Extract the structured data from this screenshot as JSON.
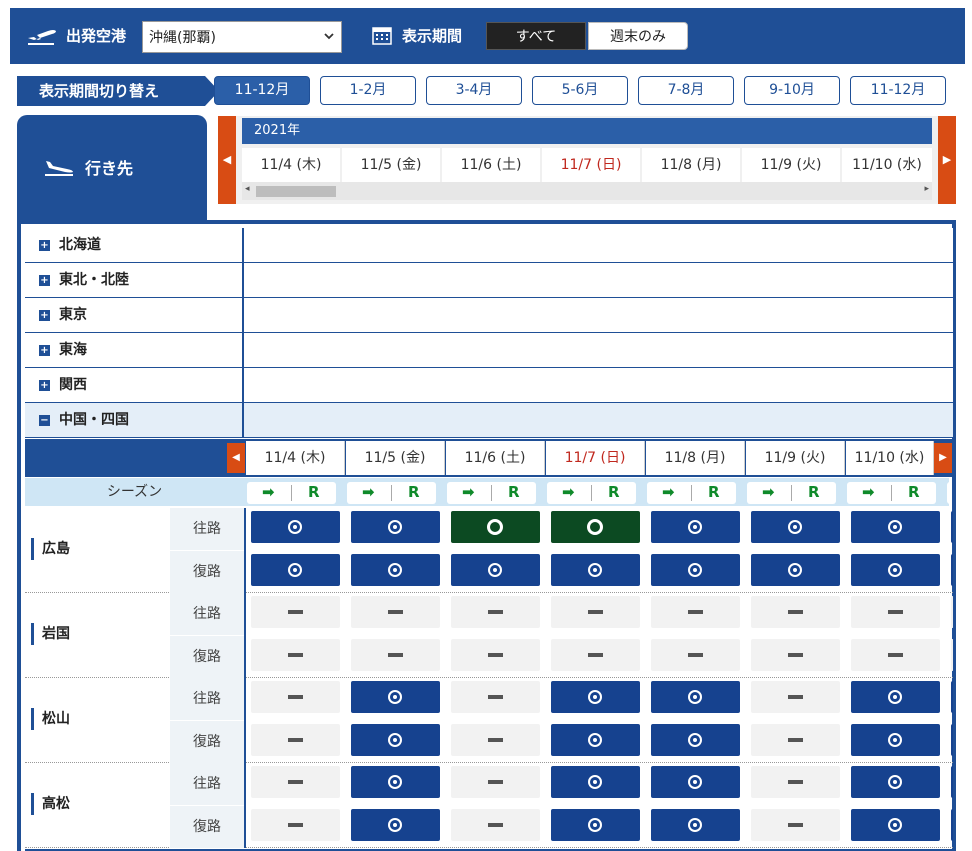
{
  "header": {
    "departure_label": "出発空港",
    "departure_value": "沖縄(那覇)",
    "period_label": "表示期間",
    "toggle_all": "すべて",
    "toggle_weekend": "週末のみ"
  },
  "period_switch": {
    "label": "表示期間切り替え",
    "options": [
      "11-12月",
      "1-2月",
      "3-4月",
      "5-6月",
      "7-8月",
      "9-10月",
      "11-12月"
    ]
  },
  "destination_label": "行き先",
  "year": "2021年",
  "dates": [
    {
      "label": "11/4 (木)",
      "color": "#333333"
    },
    {
      "label": "11/5 (金)",
      "color": "#333333"
    },
    {
      "label": "11/6 (土)",
      "color": "#333333"
    },
    {
      "label": "11/7 (日)",
      "color": "#c0281e"
    },
    {
      "label": "11/8 (月)",
      "color": "#333333"
    },
    {
      "label": "11/9 (火)",
      "color": "#333333"
    },
    {
      "label": "11/10 (水)",
      "color": "#333333"
    }
  ],
  "regions": [
    {
      "name": "北海道",
      "toggle": "+"
    },
    {
      "name": "東北・北陸",
      "toggle": "+"
    },
    {
      "name": "東京",
      "toggle": "+"
    },
    {
      "name": "東海",
      "toggle": "+"
    },
    {
      "name": "関西",
      "toggle": "+"
    },
    {
      "name": "中国・四国",
      "toggle": "−"
    }
  ],
  "season_label": "シーズン",
  "season_marks": {
    "arrow": "➡",
    "r": "R"
  },
  "directions": {
    "outbound": "往路",
    "return": "復路"
  },
  "cities": [
    {
      "name": "広島",
      "outbound": [
        "avail",
        "avail",
        "few",
        "few",
        "avail",
        "avail",
        "avail"
      ],
      "return": [
        "avail",
        "avail",
        "avail",
        "avail",
        "avail",
        "avail",
        "avail"
      ]
    },
    {
      "name": "岩国",
      "outbound": [
        "none",
        "none",
        "none",
        "none",
        "none",
        "none",
        "none"
      ],
      "return": [
        "none",
        "none",
        "none",
        "none",
        "none",
        "none",
        "none"
      ]
    },
    {
      "name": "松山",
      "outbound": [
        "none",
        "avail",
        "none",
        "avail",
        "avail",
        "none",
        "avail"
      ],
      "return": [
        "none",
        "avail",
        "none",
        "avail",
        "avail",
        "none",
        "avail"
      ]
    },
    {
      "name": "高松",
      "outbound": [
        "none",
        "avail",
        "none",
        "avail",
        "avail",
        "none",
        "avail"
      ],
      "return": [
        "none",
        "avail",
        "none",
        "avail",
        "avail",
        "none",
        "avail"
      ]
    }
  ],
  "colors": {
    "primary": "#1f4f96",
    "accent": "#d84c14",
    "available": "#16428f",
    "few_left": "#0c4a22",
    "holiday": "#c0281e"
  }
}
